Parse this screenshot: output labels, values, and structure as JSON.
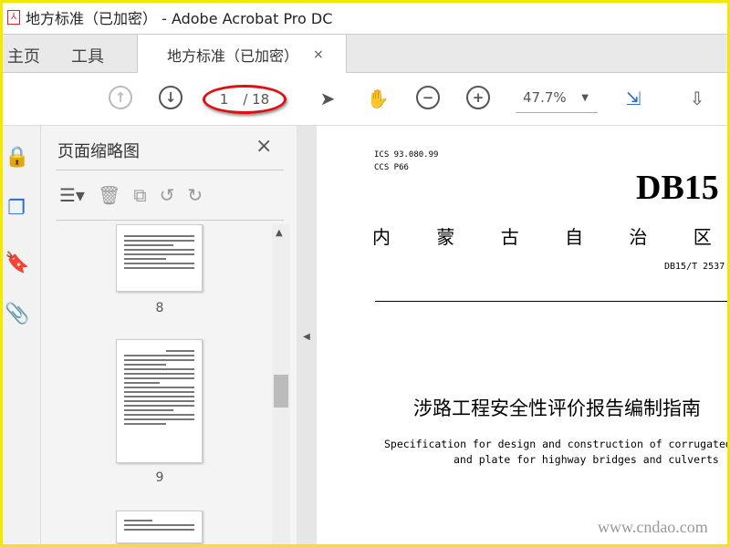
{
  "window": {
    "title": "地方标准（已加密） - Adobe Acrobat Pro DC"
  },
  "tabs": {
    "home": "主页",
    "tools": "工具",
    "document": "地方标准（已加密）",
    "close": "×"
  },
  "toolbar": {
    "page_current": "1",
    "page_total": "/ 18",
    "zoom": "47.7%"
  },
  "panel": {
    "title": "页面缩略图",
    "close": "×",
    "thumbnails": [
      {
        "label": "8"
      },
      {
        "label": "9"
      }
    ]
  },
  "document": {
    "ics": "ICS  93.080.99",
    "ccs": "CCS  P66",
    "code_large": "DB15",
    "region": "内 蒙 古 自 治 区 地 方 标",
    "standard_no": "DB15/T 2537",
    "title_cn": "涉路工程安全性评价报告编制指南",
    "title_en_line1": "Specification for design and construction of corrugated ste",
    "title_en_line2": "and plate for highway bridges and culverts",
    "watermark": "www.cndao.com"
  }
}
